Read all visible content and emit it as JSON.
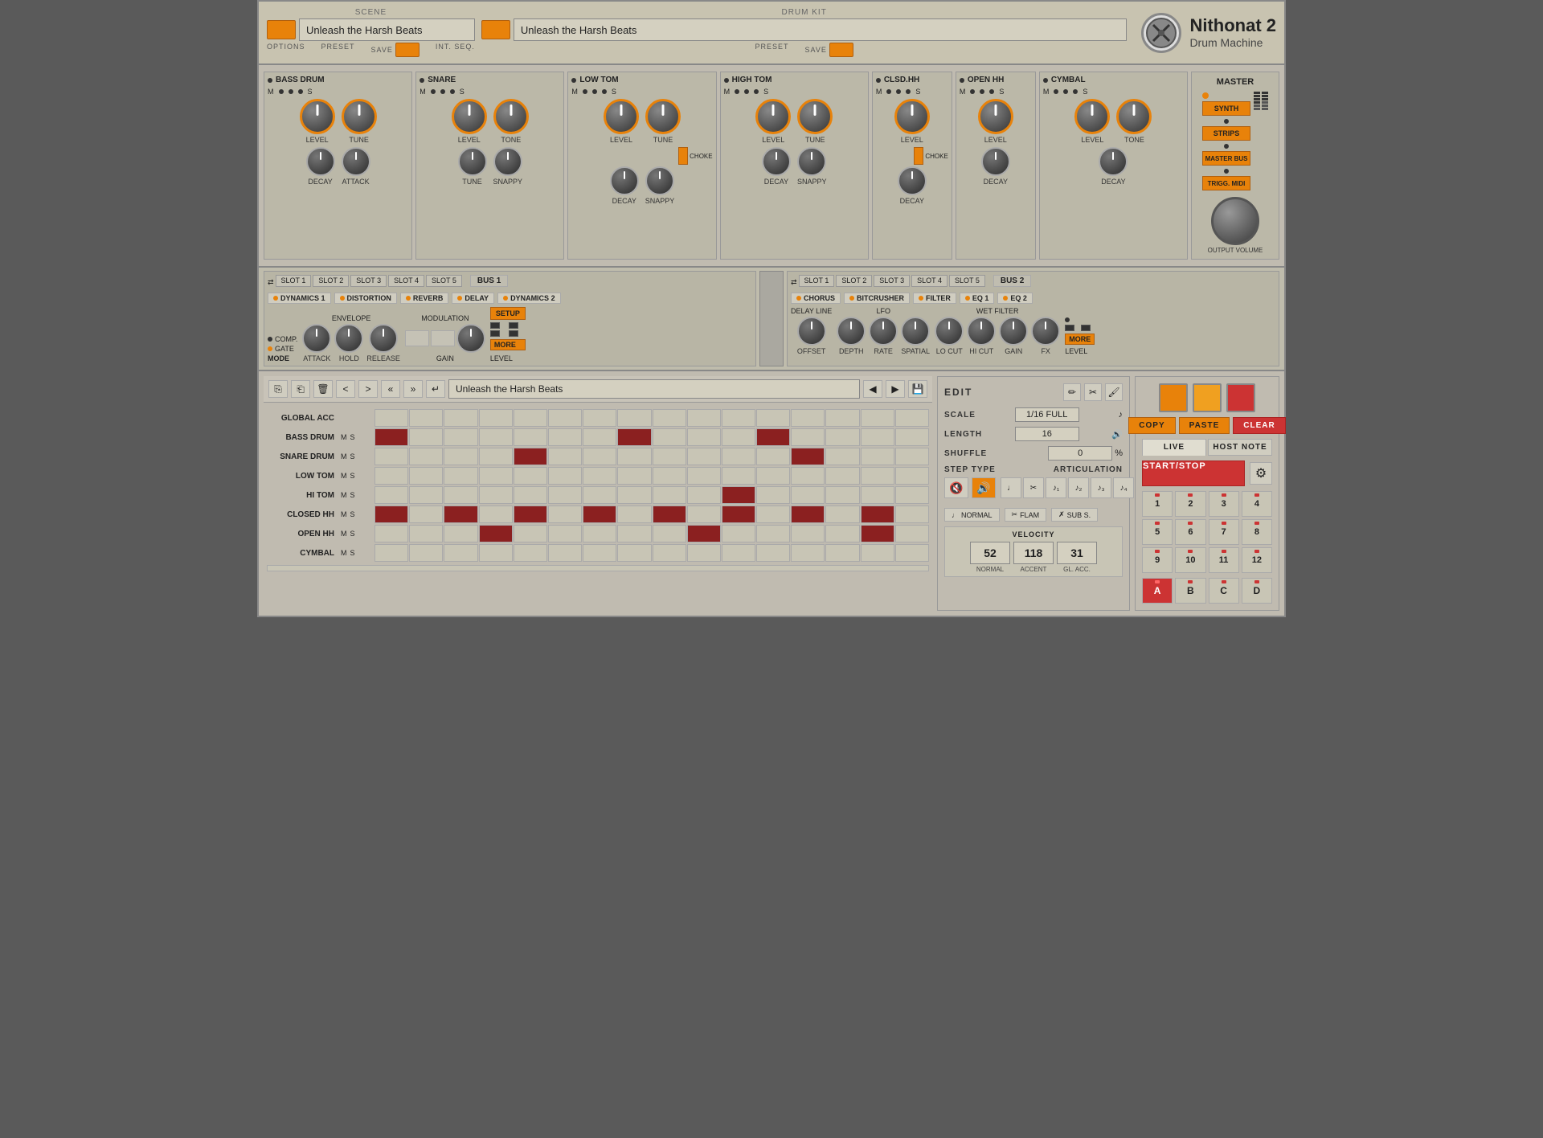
{
  "app": {
    "title": "Nithonat 2",
    "subtitle": "Drum Machine"
  },
  "header": {
    "scene_label": "SCENE",
    "drumkit_label": "DRUM KIT",
    "scene_name": "Unleash the Harsh Beats",
    "drumkit_name": "Unleash the Harsh Beats",
    "options_label": "OPTIONS",
    "preset_label": "PRESET",
    "save_label": "SAVE",
    "int_seq_label": "INT. SEQ."
  },
  "drums": {
    "channels": [
      {
        "name": "BASS DRUM",
        "knob1": "LEVEL",
        "knob2": "TUNE",
        "knob3": "DECAY",
        "knob4": "ATTACK"
      },
      {
        "name": "SNARE",
        "knob1": "LEVEL",
        "knob2": "TONE",
        "knob3": "TUNE",
        "knob4": "SNAPPY"
      },
      {
        "name": "LOW TOM",
        "knob1": "LEVEL",
        "knob2": "TUNE",
        "knob3": "DECAY",
        "knob4": "SNAPPY"
      },
      {
        "name": "HIGH TOM",
        "knob1": "LEVEL",
        "knob2": "TUNE",
        "knob3": "DECAY",
        "knob4": "SNAPPY"
      },
      {
        "name": "CLSD.HH",
        "knob1": "LEVEL",
        "knob2": "",
        "knob3": "DECAY",
        "knob4": ""
      },
      {
        "name": "OPEN HH",
        "knob1": "LEVEL",
        "knob2": "",
        "knob3": "DECAY",
        "knob4": ""
      },
      {
        "name": "CYMBAL",
        "knob1": "LEVEL",
        "knob2": "TONE",
        "knob3": "DECAY",
        "knob4": ""
      }
    ]
  },
  "master": {
    "title": "MASTER",
    "synth_label": "SYNTH",
    "strips_label": "STRIPS",
    "master_bus_label": "MASTER BUS",
    "trigg_midi_label": "TRIGG. MIDI",
    "output_volume_label": "OUTPUT VOLUME"
  },
  "bus1": {
    "label": "BUS 1",
    "slots": [
      "SLOT 1",
      "SLOT 2",
      "SLOT 3",
      "SLOT 4",
      "SLOT 5"
    ],
    "fx": [
      "DYNAMICS 1",
      "DISTORTION",
      "REVERB",
      "DELAY",
      "DYNAMICS 2"
    ],
    "controls": {
      "envelope_label": "ENVELOPE",
      "mode_label": "MODE",
      "comp_label": "COMP.",
      "gate_label": "GATE",
      "attack_label": "ATTACK",
      "hold_label": "HOLD",
      "release_label": "RELEASE",
      "modulation_label": "MODULATION",
      "gain_label": "GAIN",
      "setup_label": "SETUP",
      "more_label": "MORE",
      "level_label": "LEVEL"
    }
  },
  "bus2": {
    "label": "BUS 2",
    "slots": [
      "SLOT 1",
      "SLOT 2",
      "SLOT 3",
      "SLOT 4",
      "SLOT 5"
    ],
    "fx": [
      "CHORUS",
      "BITCRUSHER",
      "FILTER",
      "EQ 1",
      "EQ 2"
    ],
    "controls": {
      "delay_line_label": "DELAY LINE",
      "lfo_label": "LFO",
      "wet_filter_label": "WET FILTER",
      "offset_label": "OFFSET",
      "depth_label": "DEPTH",
      "rate_label": "RATE",
      "spatial_label": "SPATIAL",
      "lo_cut_label": "LO CUT",
      "hi_cut_label": "HI CUT",
      "gain_label": "GAIN",
      "fx_label": "FX",
      "more_label": "MORE",
      "level_label": "LEVEL"
    }
  },
  "sequencer": {
    "name": "Unleash the Harsh Beats",
    "rows": [
      {
        "label": "GLOBAL ACC",
        "cells": [
          0,
          0,
          0,
          0,
          0,
          0,
          0,
          0,
          0,
          0,
          0,
          0,
          0,
          0,
          0,
          0
        ]
      },
      {
        "label": "BASS DRUM",
        "cells": [
          1,
          0,
          0,
          0,
          0,
          0,
          0,
          1,
          0,
          0,
          0,
          1,
          0,
          0,
          0,
          0
        ]
      },
      {
        "label": "SNARE DRUM",
        "cells": [
          0,
          0,
          0,
          0,
          1,
          0,
          0,
          0,
          0,
          0,
          0,
          0,
          1,
          0,
          0,
          0
        ]
      },
      {
        "label": "LOW TOM",
        "cells": [
          0,
          0,
          0,
          0,
          0,
          0,
          0,
          0,
          0,
          0,
          0,
          0,
          0,
          0,
          0,
          0
        ]
      },
      {
        "label": "HI TOM",
        "cells": [
          0,
          0,
          0,
          0,
          0,
          0,
          0,
          0,
          0,
          0,
          1,
          0,
          0,
          0,
          0,
          0
        ]
      },
      {
        "label": "CLOSED HH",
        "cells": [
          1,
          0,
          1,
          0,
          1,
          0,
          1,
          0,
          1,
          0,
          1,
          0,
          1,
          0,
          1,
          0
        ]
      },
      {
        "label": "OPEN HH",
        "cells": [
          0,
          0,
          0,
          1,
          0,
          0,
          0,
          0,
          0,
          1,
          0,
          0,
          0,
          0,
          1,
          0
        ]
      },
      {
        "label": "CYMBAL",
        "cells": [
          0,
          0,
          0,
          0,
          0,
          0,
          0,
          0,
          0,
          0,
          0,
          0,
          0,
          0,
          0,
          0
        ]
      }
    ]
  },
  "edit": {
    "title": "EDIT",
    "scale_label": "SCALE",
    "scale_value": "1/16 FULL",
    "length_label": "LENGTH",
    "length_value": "16",
    "shuffle_label": "SHUFFLE",
    "shuffle_value": "0",
    "shuffle_unit": "%",
    "step_type_label": "STEP TYPE",
    "articulation_label": "ARTICULATION",
    "normal_label": "NORMAL",
    "flam_label": "FLAM",
    "sub_s_label": "SUB S.",
    "velocity_label": "VELOCITY",
    "vel_normal": "52",
    "vel_accent": "118",
    "vel_gl_acc": "31",
    "vel_normal_label": "NORMAL",
    "vel_accent_label": "ACCENT",
    "vel_gl_acc_label": "GL. ACC."
  },
  "right_panel": {
    "copy_label": "COPY",
    "paste_label": "PASTE",
    "clear_label": "CLEAR",
    "live_label": "LIVE",
    "host_note_label": "HOST NOTE",
    "start_stop_label": "START/STOP",
    "num_buttons": [
      "1",
      "2",
      "3",
      "4",
      "5",
      "6",
      "7",
      "8",
      "9",
      "10",
      "11",
      "12"
    ],
    "letter_buttons": [
      "A",
      "B",
      "C",
      "D"
    ]
  }
}
